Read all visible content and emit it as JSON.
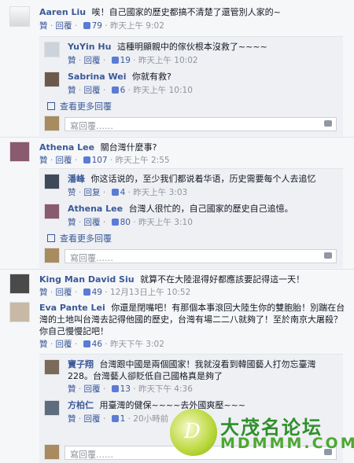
{
  "input_placeholder": "寫回覆……",
  "more_replies_label": "查看更多回覆",
  "comments": [
    {
      "name": "Aaren Liu",
      "text": "唉！自己國家的歷史都搞不清楚了還管別人家的~",
      "like": "贊",
      "reply": "回覆",
      "count": "79",
      "time": "昨天上午 9:02"
    },
    {
      "name": "YuYin Hu",
      "text": "這種明顯親中的傢伙根本沒救了~~~~",
      "like": "贊",
      "reply": "回覆",
      "count": "19",
      "time": "昨天上午 10:02"
    },
    {
      "name": "Sabrina Wei",
      "text": "你就有救?",
      "like": "贊",
      "reply": "回覆",
      "count": "6",
      "time": "昨天上午 10:10"
    },
    {
      "name": "Athena Lee",
      "text": "關台灣什麼事?",
      "like": "贊",
      "reply": "回覆",
      "count": "107",
      "time": "昨天上午 2:55"
    },
    {
      "name": "潘峰",
      "text": "你这话说的，至少我们都说着华语，历史需要每个人去追忆",
      "like": "赞",
      "reply": "回复",
      "count": "4",
      "time": "昨天上午 3:03"
    },
    {
      "name": "Athena Lee",
      "text": "台灣人很忙的，自己國家的歷史自己追憶。",
      "like": "贊",
      "reply": "回覆",
      "count": "80",
      "time": "昨天上午 3:10"
    },
    {
      "name": "King Man David Siu",
      "text": "就算不在大陸混得好都應該要記得這一天！",
      "like": "贊",
      "reply": "回覆",
      "count": "49",
      "time": "12月13日上午 10:52"
    },
    {
      "name": "Eva Pante Lei",
      "text": "你還是閉嘴吧！有那個本事滾回大陸生你的雙胞胎！別踹在台灣的土地叫台灣去記得他國的歷史，台灣有場二二八就夠了！至於南京大屠殺？你自己慢慢記吧！",
      "like": "贊",
      "reply": "回覆",
      "count": "46",
      "time": "昨天下午 3:02"
    },
    {
      "name": "寶子翔",
      "text": "台灣跟中國是兩個國家！我就沒看到韓國藝人打勿忘臺灣228。台灣藝人卻貶低自己國格真是夠了",
      "like": "贊",
      "reply": "回覆",
      "count": "13",
      "time": "昨天下午 4:36"
    },
    {
      "name": "方柏仁",
      "text": "用臺灣的健保~~~~去外國爽壓~~~",
      "like": "贊",
      "reply": "回覆",
      "count": "1",
      "time": "20小時前"
    }
  ],
  "watermark": {
    "title": "大茂名论坛",
    "subtitle": "MDMMM.COM"
  }
}
